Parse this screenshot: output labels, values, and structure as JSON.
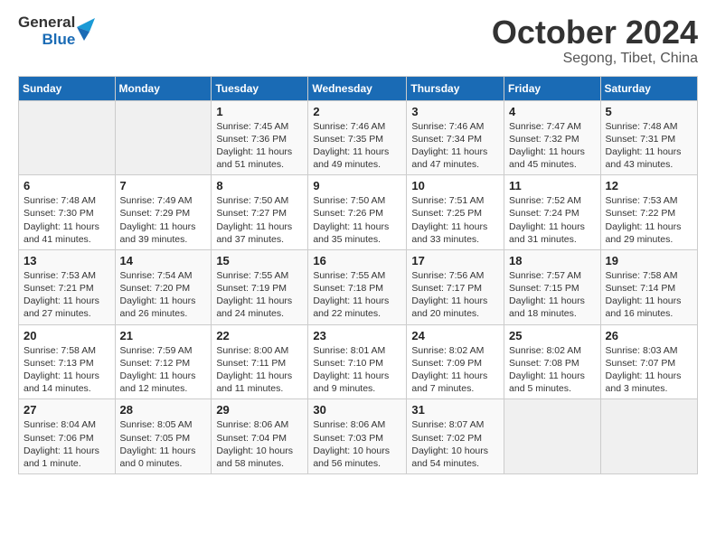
{
  "logo": {
    "text_general": "General",
    "text_blue": "Blue"
  },
  "title": "October 2024",
  "subtitle": "Segong, Tibet, China",
  "days_of_week": [
    "Sunday",
    "Monday",
    "Tuesday",
    "Wednesday",
    "Thursday",
    "Friday",
    "Saturday"
  ],
  "weeks": [
    [
      {
        "day": "",
        "sunrise": "",
        "sunset": "",
        "daylight": ""
      },
      {
        "day": "",
        "sunrise": "",
        "sunset": "",
        "daylight": ""
      },
      {
        "day": "1",
        "sunrise": "Sunrise: 7:45 AM",
        "sunset": "Sunset: 7:36 PM",
        "daylight": "Daylight: 11 hours and 51 minutes."
      },
      {
        "day": "2",
        "sunrise": "Sunrise: 7:46 AM",
        "sunset": "Sunset: 7:35 PM",
        "daylight": "Daylight: 11 hours and 49 minutes."
      },
      {
        "day": "3",
        "sunrise": "Sunrise: 7:46 AM",
        "sunset": "Sunset: 7:34 PM",
        "daylight": "Daylight: 11 hours and 47 minutes."
      },
      {
        "day": "4",
        "sunrise": "Sunrise: 7:47 AM",
        "sunset": "Sunset: 7:32 PM",
        "daylight": "Daylight: 11 hours and 45 minutes."
      },
      {
        "day": "5",
        "sunrise": "Sunrise: 7:48 AM",
        "sunset": "Sunset: 7:31 PM",
        "daylight": "Daylight: 11 hours and 43 minutes."
      }
    ],
    [
      {
        "day": "6",
        "sunrise": "Sunrise: 7:48 AM",
        "sunset": "Sunset: 7:30 PM",
        "daylight": "Daylight: 11 hours and 41 minutes."
      },
      {
        "day": "7",
        "sunrise": "Sunrise: 7:49 AM",
        "sunset": "Sunset: 7:29 PM",
        "daylight": "Daylight: 11 hours and 39 minutes."
      },
      {
        "day": "8",
        "sunrise": "Sunrise: 7:50 AM",
        "sunset": "Sunset: 7:27 PM",
        "daylight": "Daylight: 11 hours and 37 minutes."
      },
      {
        "day": "9",
        "sunrise": "Sunrise: 7:50 AM",
        "sunset": "Sunset: 7:26 PM",
        "daylight": "Daylight: 11 hours and 35 minutes."
      },
      {
        "day": "10",
        "sunrise": "Sunrise: 7:51 AM",
        "sunset": "Sunset: 7:25 PM",
        "daylight": "Daylight: 11 hours and 33 minutes."
      },
      {
        "day": "11",
        "sunrise": "Sunrise: 7:52 AM",
        "sunset": "Sunset: 7:24 PM",
        "daylight": "Daylight: 11 hours and 31 minutes."
      },
      {
        "day": "12",
        "sunrise": "Sunrise: 7:53 AM",
        "sunset": "Sunset: 7:22 PM",
        "daylight": "Daylight: 11 hours and 29 minutes."
      }
    ],
    [
      {
        "day": "13",
        "sunrise": "Sunrise: 7:53 AM",
        "sunset": "Sunset: 7:21 PM",
        "daylight": "Daylight: 11 hours and 27 minutes."
      },
      {
        "day": "14",
        "sunrise": "Sunrise: 7:54 AM",
        "sunset": "Sunset: 7:20 PM",
        "daylight": "Daylight: 11 hours and 26 minutes."
      },
      {
        "day": "15",
        "sunrise": "Sunrise: 7:55 AM",
        "sunset": "Sunset: 7:19 PM",
        "daylight": "Daylight: 11 hours and 24 minutes."
      },
      {
        "day": "16",
        "sunrise": "Sunrise: 7:55 AM",
        "sunset": "Sunset: 7:18 PM",
        "daylight": "Daylight: 11 hours and 22 minutes."
      },
      {
        "day": "17",
        "sunrise": "Sunrise: 7:56 AM",
        "sunset": "Sunset: 7:17 PM",
        "daylight": "Daylight: 11 hours and 20 minutes."
      },
      {
        "day": "18",
        "sunrise": "Sunrise: 7:57 AM",
        "sunset": "Sunset: 7:15 PM",
        "daylight": "Daylight: 11 hours and 18 minutes."
      },
      {
        "day": "19",
        "sunrise": "Sunrise: 7:58 AM",
        "sunset": "Sunset: 7:14 PM",
        "daylight": "Daylight: 11 hours and 16 minutes."
      }
    ],
    [
      {
        "day": "20",
        "sunrise": "Sunrise: 7:58 AM",
        "sunset": "Sunset: 7:13 PM",
        "daylight": "Daylight: 11 hours and 14 minutes."
      },
      {
        "day": "21",
        "sunrise": "Sunrise: 7:59 AM",
        "sunset": "Sunset: 7:12 PM",
        "daylight": "Daylight: 11 hours and 12 minutes."
      },
      {
        "day": "22",
        "sunrise": "Sunrise: 8:00 AM",
        "sunset": "Sunset: 7:11 PM",
        "daylight": "Daylight: 11 hours and 11 minutes."
      },
      {
        "day": "23",
        "sunrise": "Sunrise: 8:01 AM",
        "sunset": "Sunset: 7:10 PM",
        "daylight": "Daylight: 11 hours and 9 minutes."
      },
      {
        "day": "24",
        "sunrise": "Sunrise: 8:02 AM",
        "sunset": "Sunset: 7:09 PM",
        "daylight": "Daylight: 11 hours and 7 minutes."
      },
      {
        "day": "25",
        "sunrise": "Sunrise: 8:02 AM",
        "sunset": "Sunset: 7:08 PM",
        "daylight": "Daylight: 11 hours and 5 minutes."
      },
      {
        "day": "26",
        "sunrise": "Sunrise: 8:03 AM",
        "sunset": "Sunset: 7:07 PM",
        "daylight": "Daylight: 11 hours and 3 minutes."
      }
    ],
    [
      {
        "day": "27",
        "sunrise": "Sunrise: 8:04 AM",
        "sunset": "Sunset: 7:06 PM",
        "daylight": "Daylight: 11 hours and 1 minute."
      },
      {
        "day": "28",
        "sunrise": "Sunrise: 8:05 AM",
        "sunset": "Sunset: 7:05 PM",
        "daylight": "Daylight: 11 hours and 0 minutes."
      },
      {
        "day": "29",
        "sunrise": "Sunrise: 8:06 AM",
        "sunset": "Sunset: 7:04 PM",
        "daylight": "Daylight: 10 hours and 58 minutes."
      },
      {
        "day": "30",
        "sunrise": "Sunrise: 8:06 AM",
        "sunset": "Sunset: 7:03 PM",
        "daylight": "Daylight: 10 hours and 56 minutes."
      },
      {
        "day": "31",
        "sunrise": "Sunrise: 8:07 AM",
        "sunset": "Sunset: 7:02 PM",
        "daylight": "Daylight: 10 hours and 54 minutes."
      },
      {
        "day": "",
        "sunrise": "",
        "sunset": "",
        "daylight": ""
      },
      {
        "day": "",
        "sunrise": "",
        "sunset": "",
        "daylight": ""
      }
    ]
  ]
}
